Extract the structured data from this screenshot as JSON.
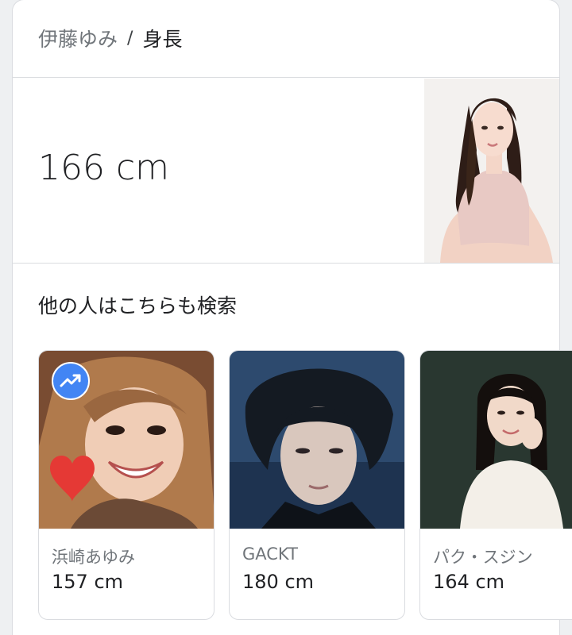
{
  "breadcrumb": {
    "entity": "伊藤ゆみ",
    "separator": "/",
    "attribute": "身長"
  },
  "answer": {
    "value": "166 cm"
  },
  "related": {
    "title": "他の人はこちらも検索",
    "people": [
      {
        "name": "浜崎あゆみ",
        "value": "157 cm",
        "badge_icon": "trending-up-icon"
      },
      {
        "name": "GACKT",
        "value": "180 cm"
      },
      {
        "name": "パク・スジン",
        "value": "164 cm"
      }
    ]
  },
  "colors": {
    "badge": "#4285f4",
    "heart": "#e53935",
    "muted_text": "#70757a",
    "primary_text": "#202124",
    "divider": "#dadce0"
  }
}
